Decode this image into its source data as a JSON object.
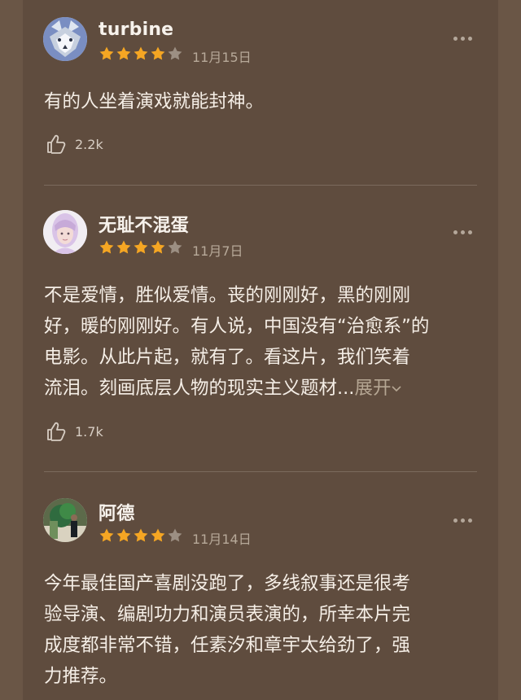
{
  "reviews": [
    {
      "username": "turbine",
      "rating": 4,
      "max_rating": 5,
      "date": "11月15日",
      "text": "有的人坐着演戏就能封神。",
      "likes": "2.2k",
      "avatar": "wolf-avatar"
    },
    {
      "username": "无耻不混蛋",
      "rating": 4,
      "max_rating": 5,
      "date": "11月7日",
      "text": "不是爱情，胜似爱情。丧的刚刚好，黑的刚刚\n好，暖的刚刚好。有人说，中国没有“治愈系”的\n电影。从此片起，就有了。看这片，我们笑着\n流泪。刻画底层人物的现实主义题材...",
      "expand_label": "展开",
      "likes": "1.7k",
      "avatar": "girl-avatar"
    },
    {
      "username": "阿德",
      "rating": 4,
      "max_rating": 5,
      "date": "11月14日",
      "text": "今年最佳国产喜剧没跑了，多线叙事还是很考\n验导演、编剧功力和演员表演的，所幸本片完\n成度都非常不错，任素汐和章宇太给劲了，强\n力推荐。",
      "avatar": "street-avatar"
    }
  ],
  "colors": {
    "star_filled": "#f5a623",
    "star_empty": "#9c8f83",
    "background": "#5f4c3e"
  }
}
